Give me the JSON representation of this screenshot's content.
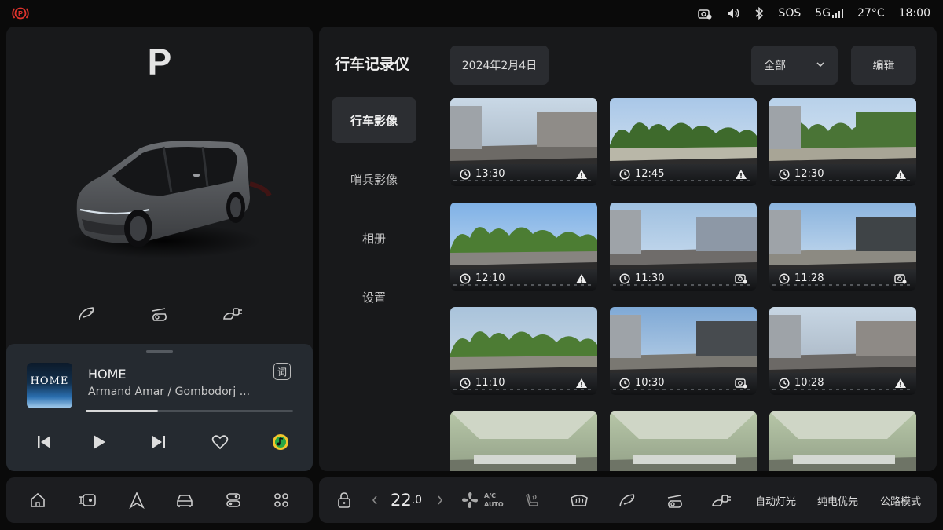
{
  "status": {
    "sos": "SOS",
    "network": "5G",
    "temperature": "27°C",
    "time": "18:00"
  },
  "vehicle": {
    "gear": "P"
  },
  "music": {
    "album_text": "HOME",
    "title": "HOME",
    "artist": "Armand Amar / Gombodorj ...",
    "lyrics_label": "词",
    "progress_fraction": 0.35
  },
  "recorder": {
    "title": "行车记录仪",
    "nav": [
      {
        "label": "行车影像",
        "active": true
      },
      {
        "label": "哨兵影像",
        "active": false
      },
      {
        "label": "相册",
        "active": false
      },
      {
        "label": "设置",
        "active": false
      }
    ],
    "date": "2024年2月4日",
    "filter": "全部",
    "edit": "编辑",
    "clips": [
      {
        "time": "13:30",
        "badge": "warning-icon"
      },
      {
        "time": "12:45",
        "badge": "warning-icon"
      },
      {
        "time": "12:30",
        "badge": "warning-icon"
      },
      {
        "time": "12:10",
        "badge": "warning-icon"
      },
      {
        "time": "11:30",
        "badge": "photo-icon"
      },
      {
        "time": "11:28",
        "badge": "photo-icon"
      },
      {
        "time": "11:10",
        "badge": "warning-icon"
      },
      {
        "time": "10:30",
        "badge": "photo-icon"
      },
      {
        "time": "10:28",
        "badge": "warning-icon"
      },
      {
        "time": "",
        "badge": ""
      },
      {
        "time": "",
        "badge": ""
      },
      {
        "time": "",
        "badge": ""
      }
    ]
  },
  "climate": {
    "temp_value": "22",
    "temp_decimal": ".0",
    "ac_label_top": "A/C",
    "ac_label_bottom": "AUTO"
  },
  "dock_right": {
    "auto_lights": "自动灯光",
    "ev_priority": "纯电优先",
    "road_mode": "公路模式"
  }
}
